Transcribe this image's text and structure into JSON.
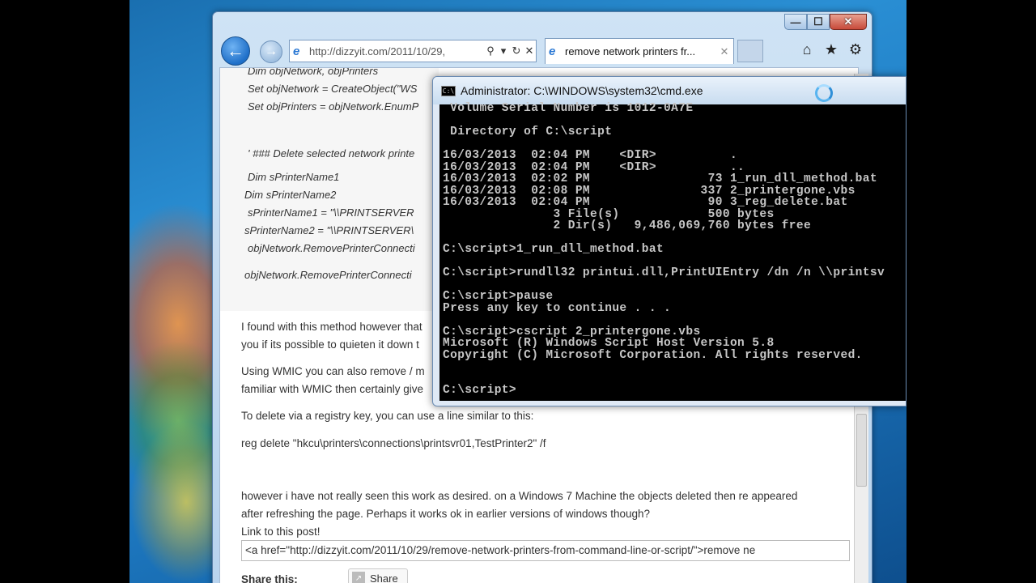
{
  "ie": {
    "address_url": "http://dizzyit.com/2011/10/29,",
    "tab_title": "remove network printers fr...",
    "caption": {
      "minimize": "—",
      "maximize": "☐",
      "close": "✕"
    }
  },
  "page": {
    "code_lines": [
      "Dim objNetwork, objPrinters",
      "Set objNetwork = CreateObject(\"WS",
      "Set objPrinters = objNetwork.EnumP",
      "' ### Delete selected network printe",
      "Dim sPrinterName1",
      "Dim sPrinterName2",
      "sPrinterName1 = \"\\\\PRINTSERVER",
      "sPrinterName2 = \"\\\\PRINTSERVER\\",
      "objNetwork.RemovePrinterConnecti",
      "objNetwork.RemovePrinterConnecti"
    ],
    "para1_line1": "I found with this method however that",
    "para1_line2": "you if its possible to quieten it down t",
    "para2_line1": "Using WMIC you can also remove / m",
    "para2_line2": "familiar with WMIC then certainly give",
    "registry_intro": "To delete via a registry key, you can use a line similar to this:",
    "reg_command": "reg delete \"hkcu\\printers\\connections\\printsvr01,TestPrinter2\" /f",
    "para3_line1": "however i have not really seen this work as desired. on a Windows 7 Machine the objects deleted then re appeared",
    "para3_line2": "after refreshing the page. Perhaps it works ok in earlier versions of windows though?",
    "link_label": "Link to this post!",
    "link_html": "<a href=\"http://dizzyit.com/2011/10/29/remove-network-printers-from-command-line-or-script/\">remove ne",
    "share_title": "Share this:",
    "share_button": "Share"
  },
  "cmd": {
    "title": "Administrator: C:\\WINDOWS\\system32\\cmd.exe",
    "lines": [
      " Volume Serial Number is 1012-0A7E",
      "",
      " Directory of C:\\script",
      "",
      "16/03/2013  02:04 PM    <DIR>          .",
      "16/03/2013  02:04 PM    <DIR>          ..",
      "16/03/2013  02:02 PM                73 1_run_dll_method.bat",
      "16/03/2013  02:08 PM               337 2_printergone.vbs",
      "16/03/2013  02:04 PM                90 3_reg_delete.bat",
      "               3 File(s)            500 bytes",
      "               2 Dir(s)   9,486,069,760 bytes free",
      "",
      "C:\\script>1_run_dll_method.bat",
      "",
      "C:\\script>rundll32 printui.dll,PrintUIEntry /dn /n \\\\printsv",
      "",
      "C:\\script>pause",
      "Press any key to continue . . .",
      "",
      "C:\\script>cscript 2_printergone.vbs",
      "Microsoft (R) Windows Script Host Version 5.8",
      "Copyright (C) Microsoft Corporation. All rights reserved.",
      "",
      "",
      "C:\\script>"
    ]
  }
}
